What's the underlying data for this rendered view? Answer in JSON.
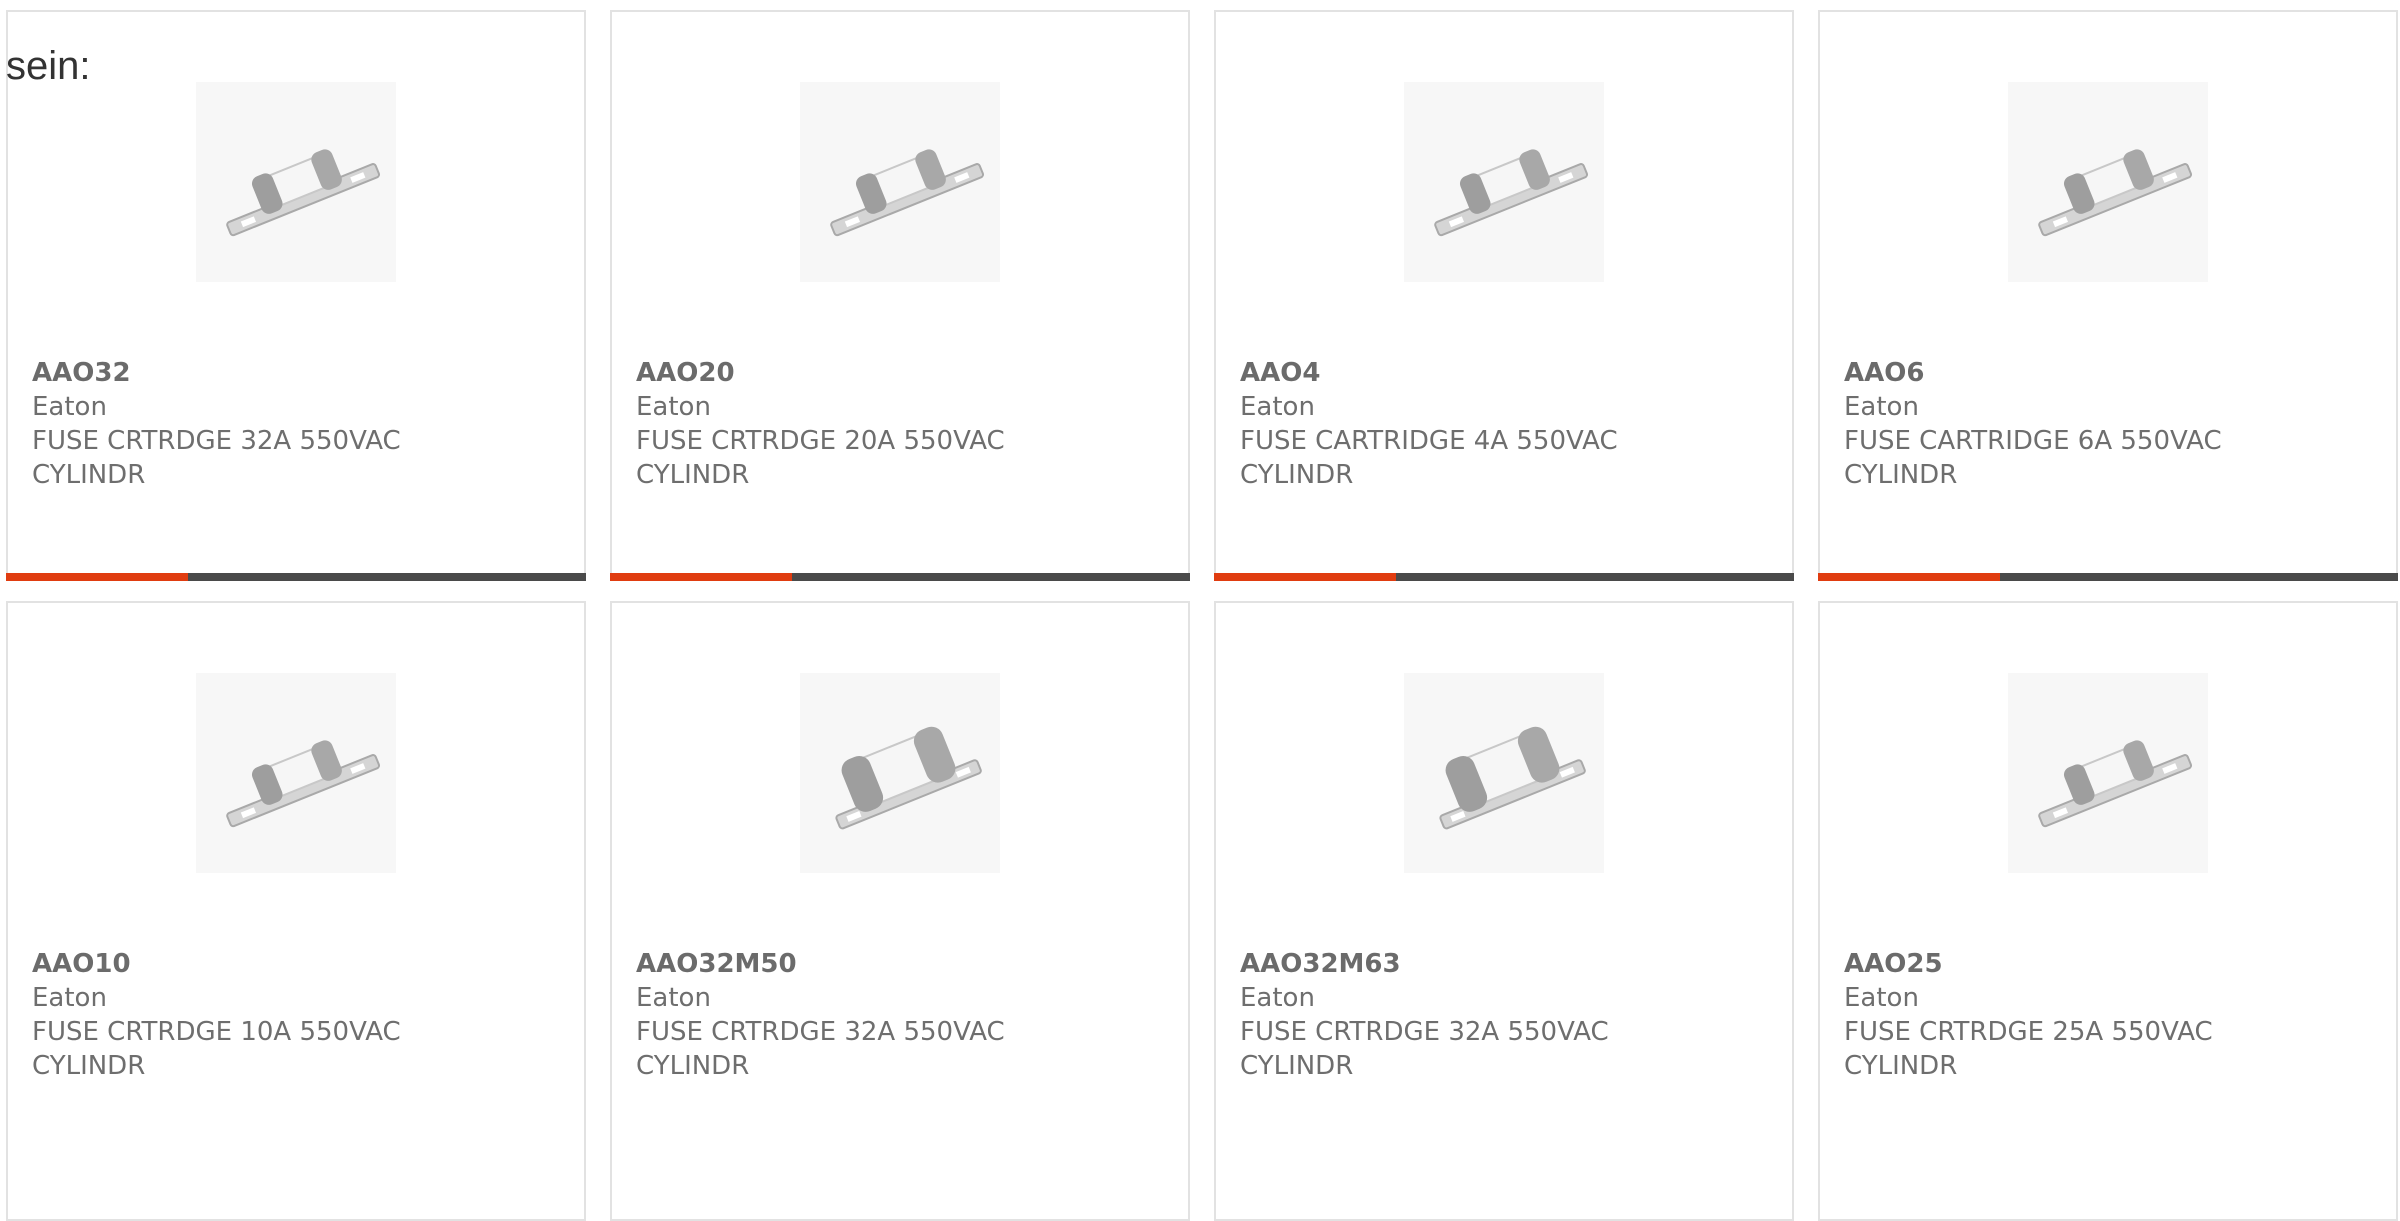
{
  "intro_text": "sein:",
  "colors": {
    "accent": "#e03c10",
    "bar": "#4a4a4a",
    "text": "#6e6e6e",
    "border": "#e2e2e2"
  },
  "products": [
    {
      "part": "AAO32",
      "manufacturer": "Eaton",
      "description": "FUSE CRTRDGE 32A 550VAC CYLINDR",
      "image_icon": "cylindrical-fuse-icon"
    },
    {
      "part": "AAO20",
      "manufacturer": "Eaton",
      "description": "FUSE CRTRDGE 20A 550VAC CYLINDR",
      "image_icon": "cylindrical-fuse-icon"
    },
    {
      "part": "AAO4",
      "manufacturer": "Eaton",
      "description": "FUSE CARTRIDGE 4A 550VAC CYLINDR",
      "image_icon": "cylindrical-fuse-icon"
    },
    {
      "part": "AAO6",
      "manufacturer": "Eaton",
      "description": "FUSE CARTRIDGE 6A 550VAC CYLINDR",
      "image_icon": "cylindrical-fuse-icon"
    },
    {
      "part": "AAO10",
      "manufacturer": "Eaton",
      "description": "FUSE CRTRDGE 10A 550VAC CYLINDR",
      "image_icon": "cylindrical-fuse-icon"
    },
    {
      "part": "AAO32M50",
      "manufacturer": "Eaton",
      "description": "FUSE CRTRDGE 32A 550VAC CYLINDR",
      "image_icon": "cylindrical-fuse-icon"
    },
    {
      "part": "AAO32M63",
      "manufacturer": "Eaton",
      "description": "FUSE CRTRDGE 32A 550VAC CYLINDR",
      "image_icon": "cylindrical-fuse-icon"
    },
    {
      "part": "AAO25",
      "manufacturer": "Eaton",
      "description": "FUSE CRTRDGE 25A 550VAC CYLINDR",
      "image_icon": "cylindrical-fuse-icon"
    }
  ]
}
